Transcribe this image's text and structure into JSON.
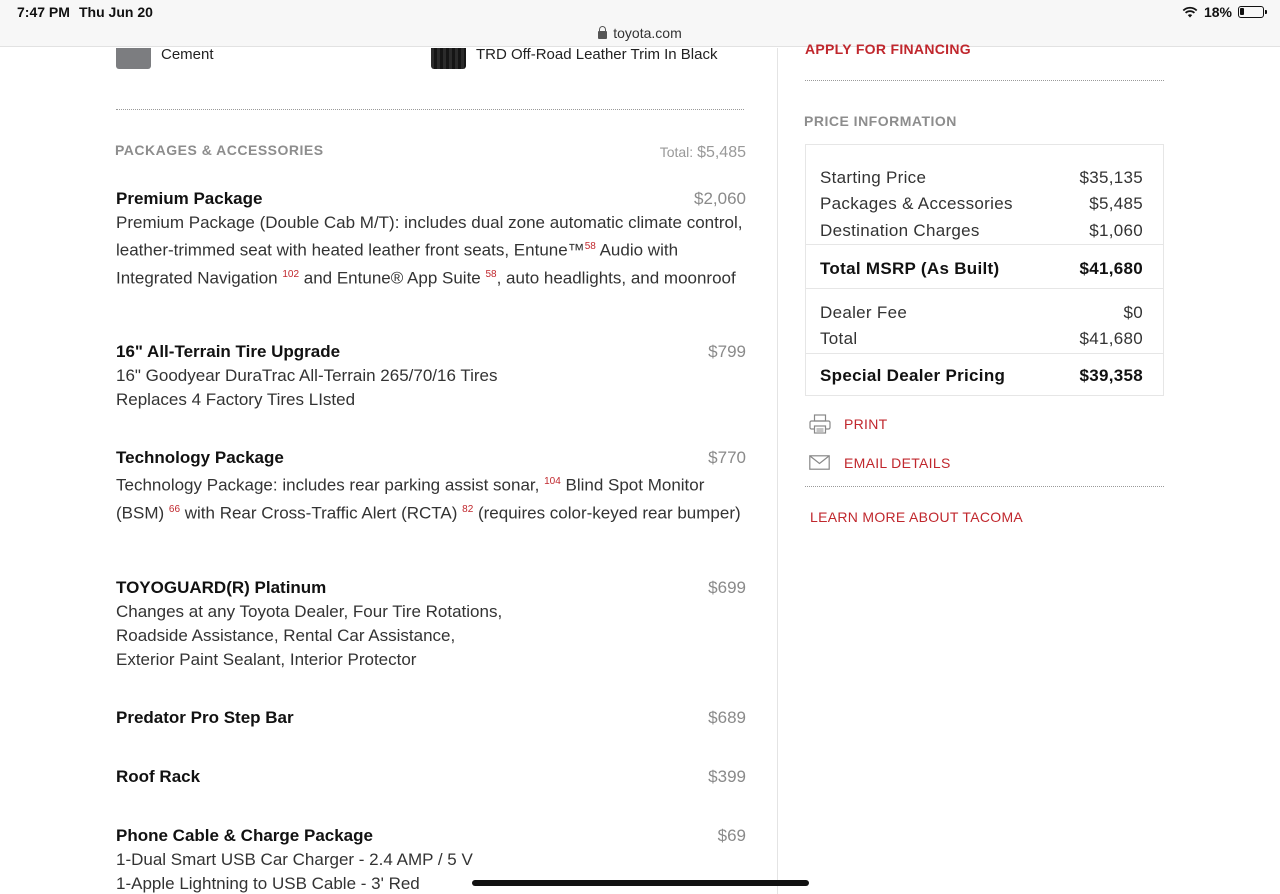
{
  "status_bar": {
    "time": "7:47 PM",
    "date": "Thu Jun 20",
    "battery_text": "18%",
    "battery_level": 0.18
  },
  "browser": {
    "url": "toyota.com"
  },
  "colors_selected": {
    "exterior": "Cement",
    "interior": "TRD Off-Road Leather Trim In Black"
  },
  "packages": {
    "heading": "PACKAGES & ACCESSORIES",
    "total_label": "Total:",
    "total_value": "$5,485",
    "items": [
      {
        "name": "Premium Package",
        "price": "$2,060",
        "desc_parts": [
          {
            "t": "Premium Package (Double Cab M/T): includes dual zone automatic climate control, leather-trimmed seat with heated leather front seats, Entune™"
          },
          {
            "sup": "58"
          },
          {
            "t": " Audio with Integrated Navigation "
          },
          {
            "sup": "102"
          },
          {
            "t": " and Entune® App Suite "
          },
          {
            "sup": "58"
          },
          {
            "t": ", auto headlights, and moonroof"
          }
        ]
      },
      {
        "name": "16\" All-Terrain Tire Upgrade",
        "price": "$799",
        "desc_lines": [
          "16\" Goodyear DuraTrac All-Terrain 265/70/16 Tires",
          "Replaces 4 Factory Tires LIsted"
        ]
      },
      {
        "name": "Technology Package",
        "price": "$770",
        "desc_parts": [
          {
            "t": "Technology Package: includes rear parking assist sonar, "
          },
          {
            "sup": "104"
          },
          {
            "t": " Blind Spot Monitor (BSM) "
          },
          {
            "sup": "66"
          },
          {
            "t": " with Rear Cross-Traffic Alert (RCTA) "
          },
          {
            "sup": "82"
          },
          {
            "t": " (requires color-keyed rear bumper)"
          }
        ]
      },
      {
        "name": "TOYOGUARD(R) Platinum",
        "price": "$699",
        "desc_lines": [
          "Changes at any Toyota Dealer, Four Tire Rotations,",
          "Roadside Assistance, Rental Car Assistance,",
          "Exterior Paint Sealant, Interior Protector"
        ]
      },
      {
        "name": "Predator Pro Step Bar",
        "price": "$689"
      },
      {
        "name": "Roof Rack",
        "price": "$399"
      },
      {
        "name": "Phone Cable & Charge Package",
        "price": "$69",
        "desc_lines": [
          "1-Dual Smart USB Car Charger - 2.4 AMP / 5 V",
          "1-Apple Lightning to USB Cable - 3' Red"
        ]
      }
    ]
  },
  "sidebar": {
    "apply_financing": "APPLY FOR FINANCING",
    "price_info_heading": "PRICE INFORMATION",
    "rows": {
      "starting_price": {
        "label": "Starting Price",
        "value": "$35,135"
      },
      "packages": {
        "label": "Packages & Accessories",
        "value": "$5,485"
      },
      "destination": {
        "label": "Destination Charges",
        "value": "$1,060"
      },
      "total_msrp": {
        "label": "Total MSRP (As Built)",
        "value": "$41,680"
      },
      "dealer_fee": {
        "label": "Dealer Fee",
        "value": "$0"
      },
      "total": {
        "label": "Total",
        "value": "$41,680"
      },
      "special_pricing": {
        "label": "Special Dealer Pricing",
        "value": "$39,358"
      }
    },
    "print_label": "PRINT",
    "email_label": "EMAIL DETAILS",
    "learn_more": "LEARN MORE ABOUT TACOMA"
  },
  "theme": {
    "accent": "#c0272d",
    "muted": "#8d8d8d"
  }
}
